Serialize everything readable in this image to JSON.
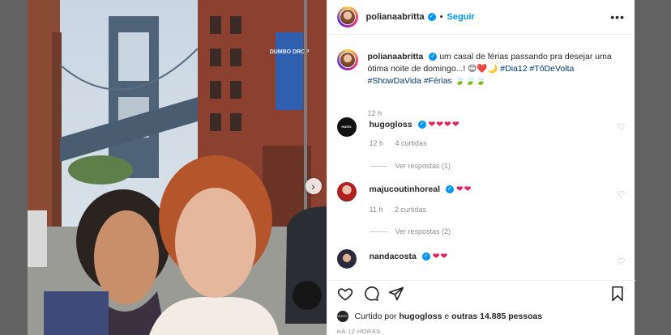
{
  "post": {
    "author": "polianaabritta",
    "follow_label": "Seguir",
    "separator": "•",
    "more": "•••",
    "next_arrow": "›"
  },
  "caption": {
    "username": "polianaabritta",
    "text": "um casal de férias passando pra desejar uma ótima noite de domingo...! 😊❤️🌙",
    "hashtags": "#Dia12 #TôDeVolta #ShowDaVida #Férias",
    "emoji_tail": "🍃🍃🍃",
    "time": "12 h"
  },
  "comments": [
    {
      "username": "hugogloss",
      "hearts": "❤❤❤❤",
      "time": "12 h",
      "likes": "4 curtidas",
      "replies": "Ver respostas (1)",
      "avatar_text": "HUGO GLOSS"
    },
    {
      "username": "majucoutinhoreal",
      "hearts": "❤❤",
      "time": "11 h",
      "likes": "2 curtidas",
      "replies": "Ver respostas (2)"
    },
    {
      "username": "nandacosta",
      "hearts": "❤❤"
    }
  ],
  "liked_by": {
    "prefix": "Curtido por",
    "user": "hugogloss",
    "conj": "e",
    "others": "outras 14.885 pessoas",
    "avatar_text": "HUGO GLOSS"
  },
  "timestamp": "HÁ 12 HORAS",
  "icons": [
    "heart-icon",
    "comment-icon",
    "share-icon",
    "bookmark-icon",
    "verified-icon",
    "more-options-icon"
  ],
  "colors": {
    "accent": "#0095f6",
    "hashtag": "#00376b",
    "hearts": "#e0245e",
    "muted": "#8e8e8e",
    "backdrop": "#626262"
  },
  "photo": {
    "banner_text": "DUMBO DROP"
  }
}
